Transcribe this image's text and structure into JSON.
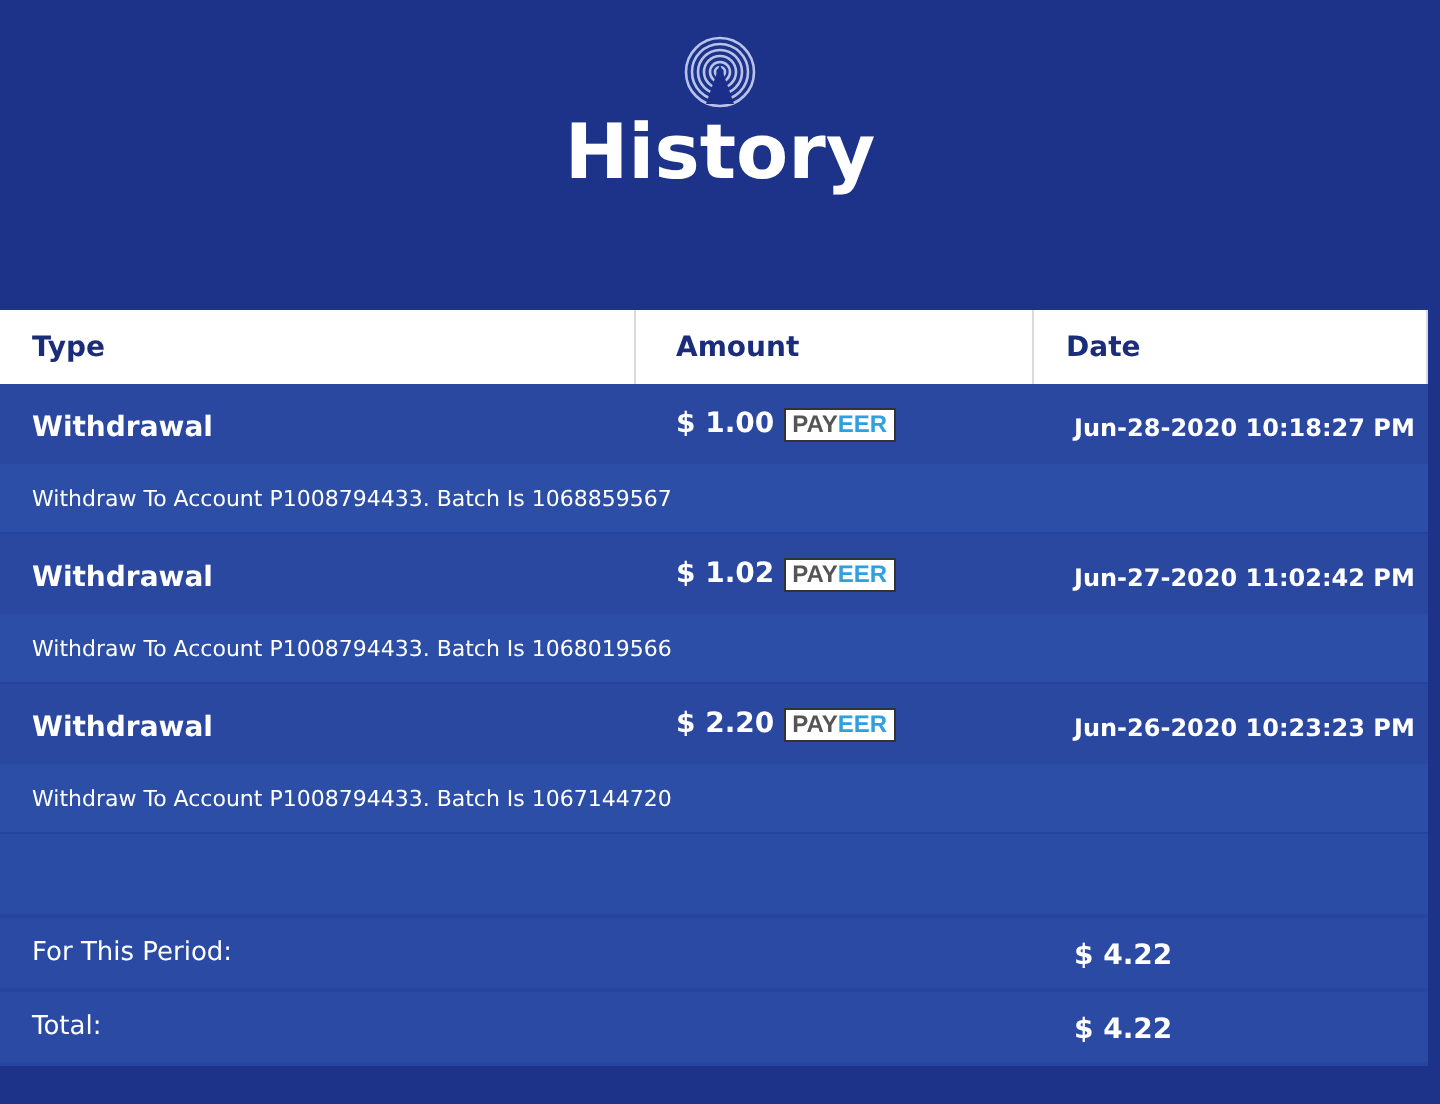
{
  "page": {
    "title": "History"
  },
  "table": {
    "columns": [
      "Type",
      "Amount",
      "Date"
    ],
    "rows": [
      {
        "type": "Withdrawal",
        "amount": "$ 1.00",
        "method": [
          "PAY",
          "EER"
        ],
        "date": "Jun-28-2020 10:18:27 PM",
        "description": "Withdraw To Account P1008794433. Batch Is 1068859567"
      },
      {
        "type": "Withdrawal",
        "amount": "$ 1.02",
        "method": [
          "PAY",
          "EER"
        ],
        "date": "Jun-27-2020 11:02:42 PM",
        "description": "Withdraw To Account P1008794433. Batch Is 1068019566"
      },
      {
        "type": "Withdrawal",
        "amount": "$ 2.20",
        "method": [
          "PAY",
          "EER"
        ],
        "date": "Jun-26-2020 10:23:23 PM",
        "description": "Withdraw To Account P1008794433. Batch Is 1067144720"
      }
    ],
    "totals": [
      {
        "label": "For This Period:",
        "value": "$ 4.22"
      },
      {
        "label": "Total:",
        "value": "$ 4.22"
      }
    ]
  }
}
